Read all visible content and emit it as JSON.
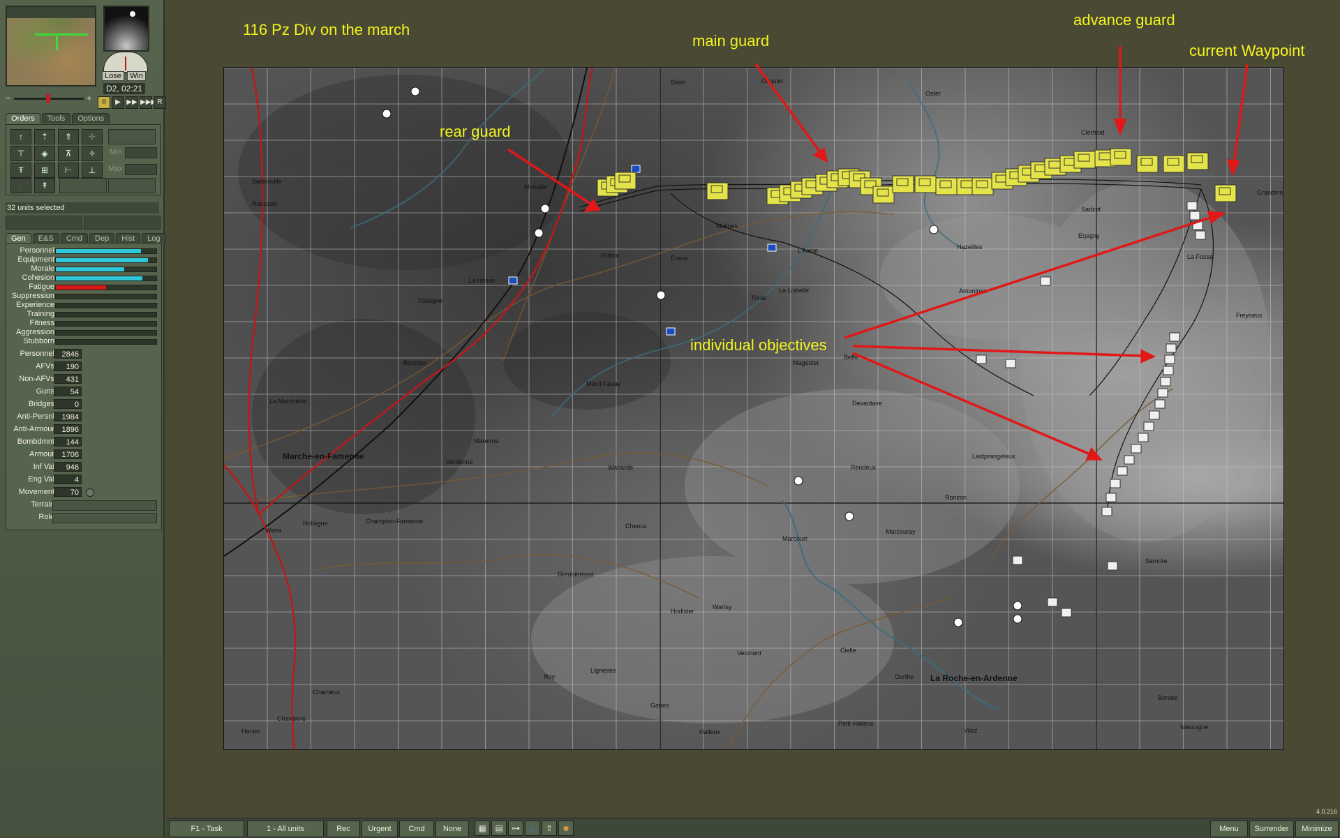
{
  "annotations": {
    "title": "116 Pz Div on the march",
    "main_guard": "main guard",
    "advance_guard": "advance guard",
    "current_waypoint": "current Waypoint",
    "rear_guard": "rear guard",
    "individual_objectives": "individual objectives",
    "color": "#f4f41e",
    "arrow_color": "#e01818"
  },
  "left_panel": {
    "lose_label": "Lose",
    "win_label": "Win",
    "time": "D2, 02:21",
    "playback": [
      "II",
      "▶",
      "▶▶",
      "▶▶▶",
      "R"
    ],
    "orders_tabs": [
      "Orders",
      "Tools",
      "Options"
    ],
    "min_label": "Min",
    "max_label": "Max",
    "units_selected": "32 units selected",
    "stat_tabs": [
      "Gen",
      "E&S",
      "Cmd",
      "Dep",
      "Hist",
      "Log"
    ],
    "bars": [
      {
        "label": "Personnel",
        "level": 0.85,
        "color": "#2ec8d8"
      },
      {
        "label": "Equipment",
        "level": 0.92,
        "color": "#2ec8d8"
      },
      {
        "label": "Morale",
        "level": 0.68,
        "color": "#2ec8d8"
      },
      {
        "label": "Cohesion",
        "level": 0.86,
        "color": "#2ec8d8"
      },
      {
        "label": "Fatigue",
        "level": 0.5,
        "color": "#d81818"
      },
      {
        "label": "Suppression",
        "level": 0,
        "color": "#2ec8d8"
      },
      {
        "label": "Experience",
        "level": 0,
        "color": "#2ec8d8"
      },
      {
        "label": "Training",
        "level": 0,
        "color": "#2ec8d8"
      },
      {
        "label": "Fitness",
        "level": 0,
        "color": "#2ec8d8"
      },
      {
        "label": "Aggression",
        "level": 0,
        "color": "#2ec8d8"
      },
      {
        "label": "Stubborn",
        "level": 0,
        "color": "#2ec8d8"
      }
    ],
    "numbers": [
      {
        "label": "Personnel",
        "value": "2846"
      },
      {
        "label": "AFVs",
        "value": "190"
      },
      {
        "label": "Non-AFVs",
        "value": "431"
      },
      {
        "label": "Guns",
        "value": "54"
      },
      {
        "label": "Bridges",
        "value": "0"
      },
      {
        "label": "Anti-Persnl",
        "value": "1984"
      },
      {
        "label": "Anti-Armour",
        "value": "1896"
      },
      {
        "label": "Bombdmnt",
        "value": "144"
      },
      {
        "label": "Armour",
        "value": "1706"
      },
      {
        "label": "Inf Val",
        "value": "946"
      },
      {
        "label": "Eng Val",
        "value": "4"
      },
      {
        "label": "Movement",
        "value": "70"
      }
    ],
    "terrain_label": "Terrain",
    "role_label": "Role"
  },
  "map": {
    "places": [
      {
        "name": "Biron"
      },
      {
        "name": "Ocquier"
      },
      {
        "name": "Oster"
      },
      {
        "name": "Clerheid"
      },
      {
        "name": "Grandmeni"
      },
      {
        "name": "Sadzot"
      },
      {
        "name": "Erpigny"
      },
      {
        "name": "Hazeilles"
      },
      {
        "name": "Baillonville"
      },
      {
        "name": "Rabozee"
      },
      {
        "name": "Monville"
      },
      {
        "name": "Melines"
      },
      {
        "name": "Hotton"
      },
      {
        "name": "La Fosse"
      },
      {
        "name": "Freyneux"
      },
      {
        "name": "Amonines"
      },
      {
        "name": "Trinal"
      },
      {
        "name": "La Lisbelle"
      },
      {
        "name": "Magoster"
      },
      {
        "name": "Beffe"
      },
      {
        "name": "Devantave"
      },
      {
        "name": "Laidprangeleux"
      },
      {
        "name": "Marche-en-Famenne",
        "big": true
      },
      {
        "name": "Marenne"
      },
      {
        "name": "Verdenne"
      },
      {
        "name": "Waharde"
      },
      {
        "name": "Rendeux"
      },
      {
        "name": "Ronzon"
      },
      {
        "name": "Hollogne"
      },
      {
        "name": "Champlon-Famenne"
      },
      {
        "name": "Cheoux"
      },
      {
        "name": "Marcourt"
      },
      {
        "name": "Marcouray"
      },
      {
        "name": "Samrée"
      },
      {
        "name": "Grimbiemont"
      },
      {
        "name": "Hodister"
      },
      {
        "name": "Warisy"
      },
      {
        "name": "Roy"
      },
      {
        "name": "Lignieres"
      },
      {
        "name": "Vecmont"
      },
      {
        "name": "Cielle"
      },
      {
        "name": "La Roche-en-Ardenne",
        "big": true
      },
      {
        "name": "Borzée"
      },
      {
        "name": "Chavanne"
      },
      {
        "name": "Harsin"
      },
      {
        "name": "Halleux"
      },
      {
        "name": "Genes"
      },
      {
        "name": "Vilez"
      },
      {
        "name": "Charneux"
      },
      {
        "name": "Fosagne"
      },
      {
        "name": "Bourdon"
      },
      {
        "name": "Menil-Favay"
      },
      {
        "name": "La Marchette"
      },
      {
        "name": "Waha"
      },
      {
        "name": "Nassogne"
      },
      {
        "name": "La Hesse"
      },
      {
        "name": "Petit Halleux"
      },
      {
        "name": "Ourthe"
      },
      {
        "name": "L'Aisne"
      },
      {
        "name": "Eveux"
      }
    ]
  },
  "bottom_bar": {
    "task": "F1 - Task",
    "units": "1 - All units",
    "rec": "Rec",
    "urgent": "Urgent",
    "cmd": "Cmd",
    "none": "None",
    "menu": "Menu",
    "surrender": "Surrender",
    "minimize": "Minimize",
    "icons": [
      "grid-icon",
      "units-icon",
      "tree-icon",
      "hq-icon",
      "arrow-up-icon",
      "portrait-icon"
    ]
  },
  "version": "4.0.216"
}
